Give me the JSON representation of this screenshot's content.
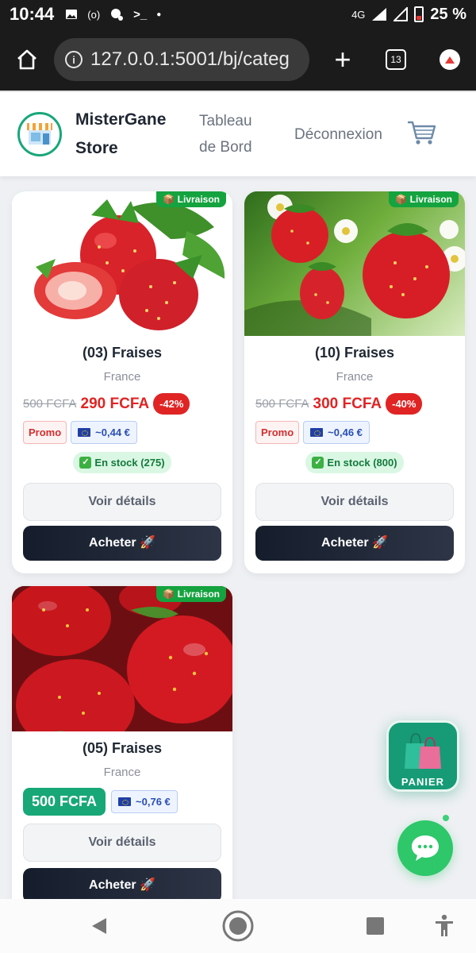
{
  "status_bar": {
    "time": "10:44",
    "network": "4G",
    "battery": "25 %"
  },
  "browser": {
    "url": "127.0.0.1:5001/bj/categ",
    "tab_count": "13"
  },
  "header": {
    "brand_line1": "MisterGane",
    "brand_line2": "Store",
    "nav_dashboard_line1": "Tableau",
    "nav_dashboard_line2": "de Bord",
    "nav_logout": "Déconnexion"
  },
  "products": [
    {
      "title": "(03) Fraises",
      "origin": "France",
      "old_price": "500 FCFA",
      "price": "290 FCFA",
      "discount": "-42%",
      "promo_tag": "Promo",
      "euro": "~0,44 €",
      "stock": "En stock (275)",
      "delivery": "Livraison",
      "details_label": "Voir détails",
      "buy_label": "Acheter 🚀"
    },
    {
      "title": "(10) Fraises",
      "origin": "France",
      "old_price": "500 FCFA",
      "price": "300 FCFA",
      "discount": "-40%",
      "promo_tag": "Promo",
      "euro": "~0,46 €",
      "stock": "En stock (800)",
      "delivery": "Livraison",
      "details_label": "Voir détails",
      "buy_label": "Acheter 🚀"
    },
    {
      "title": "(05) Fraises",
      "origin": "France",
      "price": "500 FCFA",
      "euro": "~0,76 €",
      "delivery": "Livraison",
      "details_label": "Voir détails",
      "buy_label": "Acheter 🚀"
    }
  ],
  "floating": {
    "panier_label": "PANIER"
  }
}
